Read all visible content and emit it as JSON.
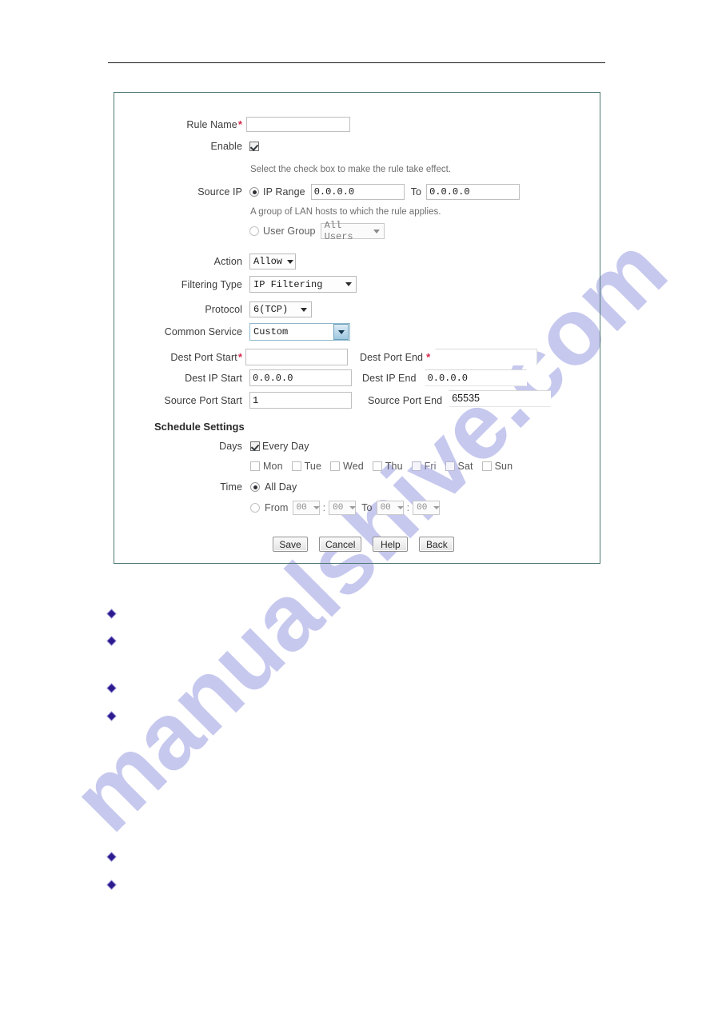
{
  "page": {
    "watermark": "manualshive.com",
    "background_color": "#ffffff",
    "panel_border_color": "#4c7873",
    "required_marker_color": "#d6254a",
    "bullet_color": "#2e1a8f"
  },
  "form": {
    "rule_name": {
      "label": "Rule Name",
      "required_marker": "*",
      "value": "",
      "placeholder": ""
    },
    "enable": {
      "label": "Enable",
      "checked": true,
      "hint": "Select the check box to make the rule take effect."
    },
    "source_ip": {
      "label": "Source IP",
      "ip_range_option": "IP Range",
      "ip_range_selected": true,
      "ip_start": "0.0.0.0",
      "to_label": "To",
      "ip_end": "0.0.0.0",
      "hint": "A group of LAN hosts to which the rule applies.",
      "user_group_option": "User Group",
      "user_group_selected": false,
      "user_group_value": "All Users"
    },
    "action": {
      "label": "Action",
      "value": "Allow"
    },
    "filtering_type": {
      "label": "Filtering Type",
      "value": "IP Filtering"
    },
    "protocol": {
      "label": "Protocol",
      "value": "6(TCP)"
    },
    "common_service": {
      "label": "Common Service",
      "value": "Custom"
    },
    "dest_port_start": {
      "label": "Dest Port Start",
      "required_marker": "*",
      "value": ""
    },
    "dest_port_end": {
      "label": "Dest Port End",
      "required_marker": "*",
      "value": ""
    },
    "dest_ip_start": {
      "label": "Dest IP Start",
      "value": "0.0.0.0"
    },
    "dest_ip_end": {
      "label": "Dest IP End",
      "value": "0.0.0.0"
    },
    "source_port_start": {
      "label": "Source Port Start",
      "value": "1"
    },
    "source_port_end": {
      "label": "Source Port End",
      "value": "65535"
    }
  },
  "schedule": {
    "title": "Schedule Settings",
    "days": {
      "label": "Days",
      "every_day_label": "Every Day",
      "every_day_checked": true,
      "day_items": [
        {
          "label": "Mon",
          "checked": false
        },
        {
          "label": "Tue",
          "checked": false
        },
        {
          "label": "Wed",
          "checked": false
        },
        {
          "label": "Thu",
          "checked": false
        },
        {
          "label": "Fri",
          "checked": false
        },
        {
          "label": "Sat",
          "checked": false
        },
        {
          "label": "Sun",
          "checked": false
        }
      ]
    },
    "time": {
      "label": "Time",
      "all_day_label": "All Day",
      "all_day_selected": true,
      "from_label": "From",
      "to_label": "To",
      "colon": ":",
      "from_hour": "00",
      "from_minute": "00",
      "to_hour": "00",
      "to_minute": "00"
    }
  },
  "buttons": {
    "save": "Save",
    "cancel": "Cancel",
    "help": "Help",
    "back": "Back"
  }
}
